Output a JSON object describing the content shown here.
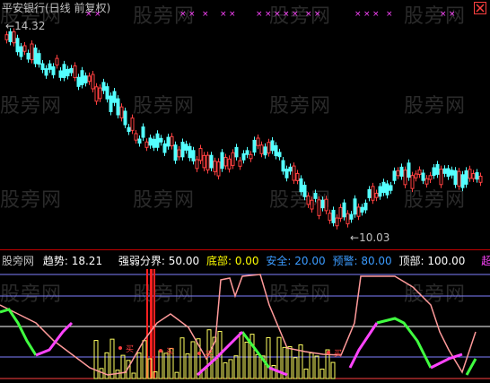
{
  "watermark": "股旁网",
  "top_panel": {
    "title": "平安银行(日线 前复权)",
    "high_label": "14.32",
    "low_label": "10.03",
    "colors": {
      "up": "#ff4040",
      "down": "#54ffff",
      "marker": "#ff44ff"
    }
  },
  "indicator_panel": {
    "prefix": "股旁网",
    "items": [
      {
        "label": "趋势:",
        "value": "18.21",
        "color": "#ffffff"
      },
      {
        "label": "强弱分界:",
        "value": "50.00",
        "color": "#ffffff"
      },
      {
        "label": "底部:",
        "value": "0.00",
        "color": "#ffff00"
      },
      {
        "label": "安全:",
        "value": "20.00",
        "color": "#3b9bff"
      },
      {
        "label": "预警:",
        "value": "80.00",
        "color": "#3b9bff"
      },
      {
        "label": "顶部:",
        "value": "100.00",
        "color": "#ffffff"
      },
      {
        "label": "超短:",
        "value": "",
        "color": "#ff44ff"
      }
    ],
    "signal_text": "买"
  },
  "icons": {
    "close": "close-icon"
  }
}
